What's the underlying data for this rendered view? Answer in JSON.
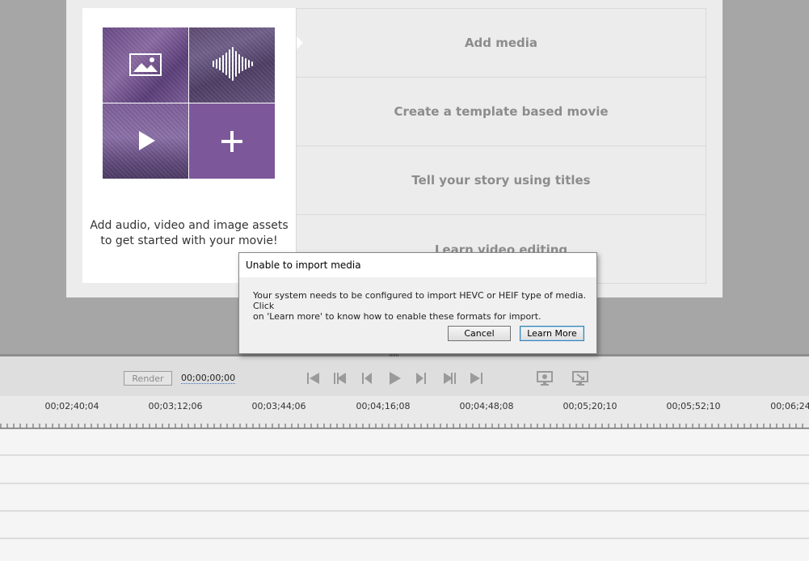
{
  "window": {
    "welcome_card": {
      "description_line1": "Add audio, video and image assets",
      "description_line2": "to get started with your movie!",
      "tiles": [
        {
          "name": "image",
          "icon": "image-icon"
        },
        {
          "name": "audio",
          "icon": "audio-waveform-icon"
        },
        {
          "name": "video",
          "icon": "play-icon"
        },
        {
          "name": "add",
          "icon": "plus-icon"
        }
      ]
    },
    "options": [
      {
        "label": "Add media"
      },
      {
        "label": "Create a template based movie"
      },
      {
        "label": "Tell your story using titles"
      },
      {
        "label": "Learn video editing"
      }
    ]
  },
  "dialog": {
    "title": "Unable to import media",
    "message_line1": "Your system needs to be configured to import HEVC or HEIF type of media. Click",
    "message_line2": "on 'Learn more' to know how to enable these formats for import.",
    "cancel_label": "Cancel",
    "learn_more_label": "Learn More"
  },
  "timeline": {
    "render_label": "Render",
    "timecode": "00;00;00;00",
    "controls": [
      "go-to-start-icon",
      "previous-clip-icon",
      "step-back-icon",
      "play-icon",
      "step-forward-icon",
      "next-clip-icon",
      "go-to-end-icon",
      "render-settings-icon",
      "fit-timeline-icon"
    ],
    "ruler_labels": [
      "00;02;40;04",
      "00;03;12;06",
      "00;03;44;06",
      "00;04;16;08",
      "00;04;48;08",
      "00;05;20;10",
      "00;05;52;10",
      "00;06;24"
    ]
  },
  "colors": {
    "tile_purple": "#7c579a",
    "option_text": "#8c8c8c",
    "dialog_default_border": "#3c7fb1"
  }
}
